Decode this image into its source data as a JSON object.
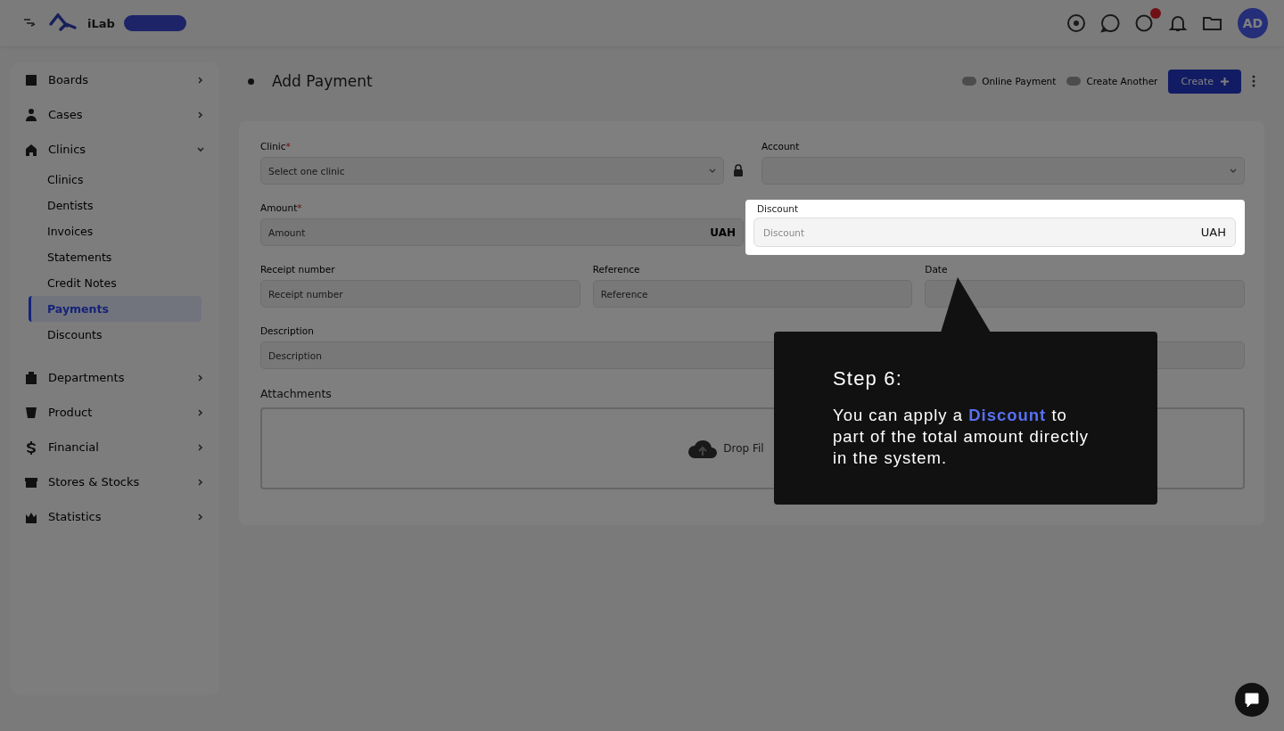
{
  "topbar": {
    "brand": "iLab",
    "avatar": "AD",
    "notification_badge": true
  },
  "sidebar": {
    "items": [
      {
        "label": "Boards",
        "expanded": false
      },
      {
        "label": "Cases",
        "expanded": false
      },
      {
        "label": "Clinics",
        "expanded": true,
        "children": [
          {
            "label": "Clinics",
            "selected": false
          },
          {
            "label": "Dentists",
            "selected": false
          },
          {
            "label": "Invoices",
            "selected": false
          },
          {
            "label": "Statements",
            "selected": false
          },
          {
            "label": "Credit Notes",
            "selected": false
          },
          {
            "label": "Payments",
            "selected": true
          },
          {
            "label": "Discounts",
            "selected": false
          }
        ]
      },
      {
        "label": "Departments",
        "expanded": false
      },
      {
        "label": "Product",
        "expanded": false
      },
      {
        "label": "Financial",
        "expanded": false
      },
      {
        "label": "Stores & Stocks",
        "expanded": false
      },
      {
        "label": "Statistics",
        "expanded": false
      }
    ]
  },
  "page": {
    "title": "Add Payment",
    "actions": [
      {
        "kind": "toggle",
        "label": "Online Payment",
        "on": false
      },
      {
        "kind": "toggle",
        "label": "Create Another",
        "on": false
      },
      {
        "kind": "primary",
        "label": "Create"
      }
    ]
  },
  "form": {
    "clinic": {
      "label": "Clinic",
      "mark": "*",
      "placeholder": "Select one clinic"
    },
    "account": {
      "label": "Account"
    },
    "amount": {
      "label": "Amount",
      "mark": "*",
      "placeholder": "Amount",
      "suffix": "UAH"
    },
    "receipt": {
      "label": "Receipt number",
      "placeholder": "Receipt number"
    },
    "reference": {
      "label": "Reference",
      "placeholder": "Reference"
    },
    "date": {
      "label": "Date"
    },
    "description": {
      "label": "Description",
      "placeholder": "Description"
    },
    "attachments": {
      "title": "Attachments",
      "drop_text": "Drop Fil"
    }
  },
  "spotlight": {
    "label": "Discount",
    "placeholder": "Discount",
    "suffix": "UAH"
  },
  "tooltip": {
    "title": "Step 6:",
    "text": "You can apply a **Discount** to part of the total amount directly in the system."
  }
}
